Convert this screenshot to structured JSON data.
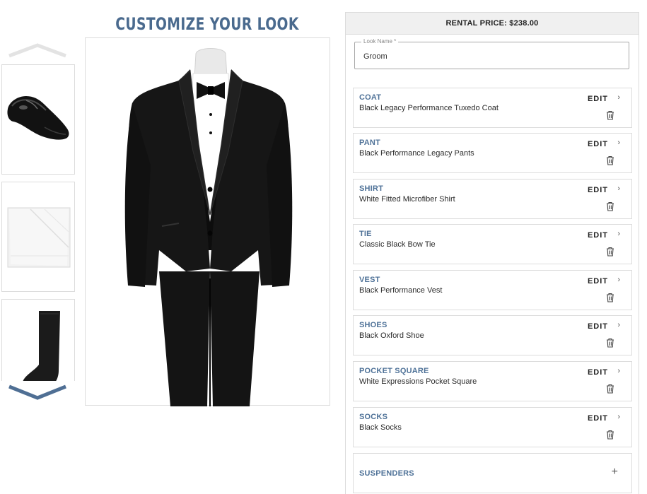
{
  "header": {
    "title": "CUSTOMIZE YOUR LOOK"
  },
  "thumbnails": {
    "up_icon": "chevron-up-icon",
    "down_icon": "chevron-down-icon",
    "items": [
      {
        "subject": "shoe"
      },
      {
        "subject": "pocket-square"
      },
      {
        "subject": "sock"
      }
    ]
  },
  "main_image": {
    "subject": "tuxedo"
  },
  "panel": {
    "rental_price": "RENTAL PRICE: $238.00",
    "look_name": {
      "label": "Look Name *",
      "value": "Groom"
    },
    "edit_label": "EDIT",
    "items": [
      {
        "category": "COAT",
        "name": "Black Legacy Performance Tuxedo Coat"
      },
      {
        "category": "PANT",
        "name": "Black Performance Legacy Pants"
      },
      {
        "category": "SHIRT",
        "name": "White Fitted Microfiber Shirt"
      },
      {
        "category": "TIE",
        "name": "Classic Black Bow Tie"
      },
      {
        "category": "VEST",
        "name": "Black Performance Vest"
      },
      {
        "category": "SHOES",
        "name": "Black Oxford Shoe"
      },
      {
        "category": "POCKET SQUARE",
        "name": "White Expressions Pocket Square"
      },
      {
        "category": "SOCKS",
        "name": "Black Socks"
      }
    ],
    "add_item": {
      "category": "SUSPENDERS",
      "icon": "plus-icon"
    }
  },
  "colors": {
    "accent": "#4f7298",
    "title": "#4a6a8e",
    "chevron_up": "#e3e3e3",
    "chevron_down": "#4f6f94"
  }
}
